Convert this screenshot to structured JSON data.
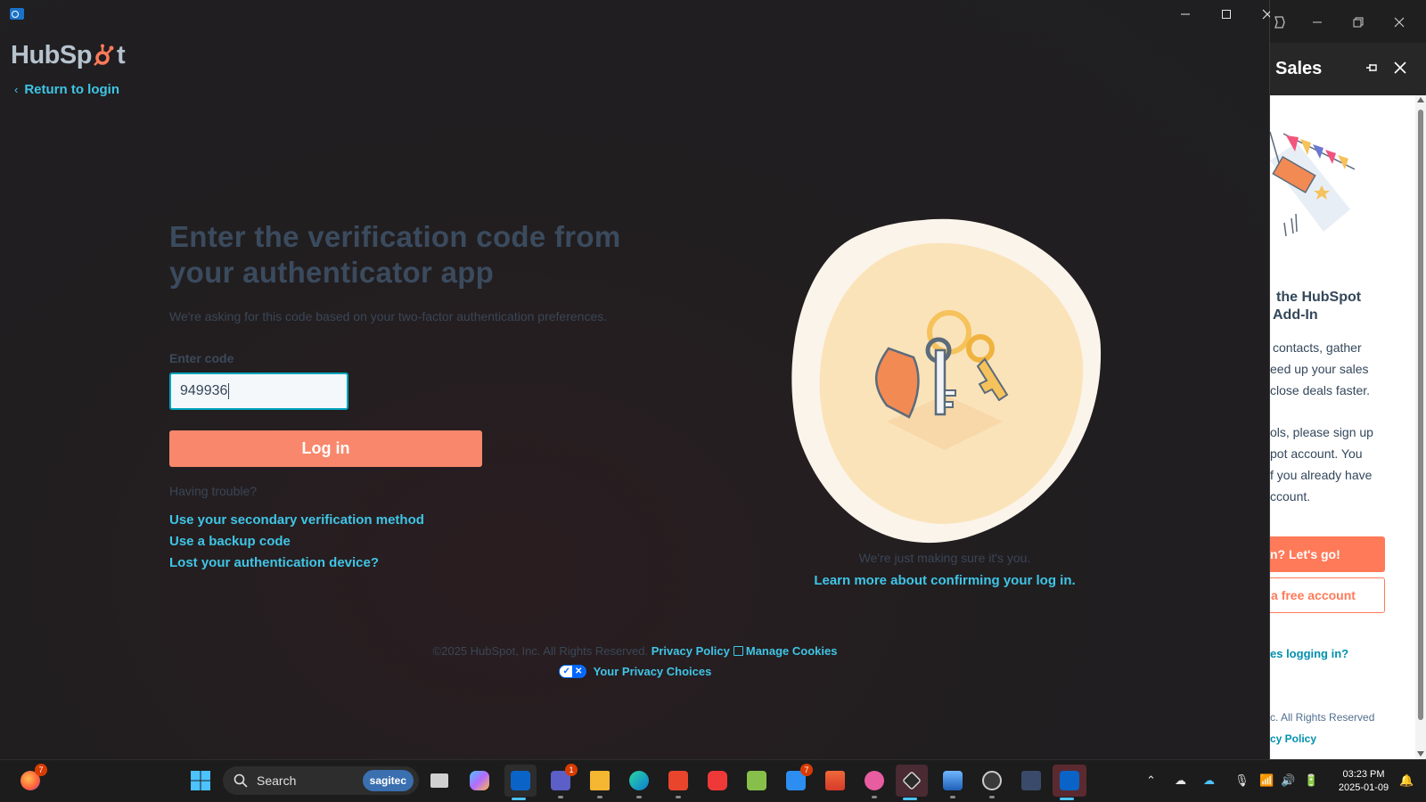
{
  "window": {
    "minimize": "─",
    "maximize": "☐",
    "close": "✕"
  },
  "brand": {
    "logo_text_1": "HubSp",
    "logo_text_2": "t"
  },
  "nav": {
    "return_label": "Return to login",
    "return_icon": "chevron-left-icon"
  },
  "form": {
    "heading": "Enter the verification code from your authenticator app",
    "subtext": "We're asking for this code based on your two-factor authentication preferences.",
    "code_label": "Enter code",
    "code_value": "949936",
    "login_label": "Log in",
    "trouble_text": "Having trouble?",
    "links": [
      "Use your secondary verification method",
      "Use a backup code",
      "Lost your authentication device?"
    ]
  },
  "illustration": {
    "caption": "We're just making sure it's you.",
    "learn_more": "Learn more about confirming your log in."
  },
  "footer": {
    "copyright": "©2025 HubSpot, Inc. All Rights Reserved.",
    "privacy_policy": "Privacy Policy",
    "manage_cookies": "Manage Cookies",
    "privacy_choices": "Your Privacy Choices"
  },
  "addin_pane": {
    "title": "Sales",
    "heading_line1": "the HubSpot",
    "heading_line2": "Add-In",
    "para1": [
      "contacts, gather",
      "eed up your sales",
      "close deals faster."
    ],
    "para2": [
      "ols, please sign up",
      "pot account. You",
      "f you already have",
      "ccount."
    ],
    "btn_primary": "n? Let's go!",
    "btn_secondary": "a free account",
    "help_link": "es logging in?",
    "footer_line1": "c. All Rights Reserved",
    "footer_line2": "cy Policy"
  },
  "taskbar": {
    "search_placeholder": "Search",
    "search_brand": "sagitec",
    "time": "03:23 PM",
    "date": "2025-01-09",
    "badges": {
      "firefox": "7",
      "teams": "1",
      "todo": "7"
    }
  },
  "colors": {
    "accent_link": "#3fc5e6",
    "button_orange": "#f8876c",
    "heading": "#3b4b5e",
    "input_border": "#00a4bd"
  }
}
